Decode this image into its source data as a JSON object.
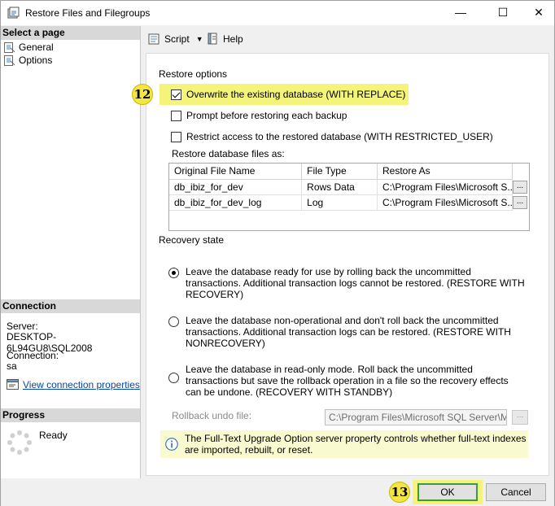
{
  "window": {
    "title": "Restore Files and Filegroups",
    "controls": {
      "minimize": "—",
      "maximize": "☐",
      "close": "✕"
    }
  },
  "left_panel": {
    "select_page_header": "Select a page",
    "pages": [
      {
        "label": "General",
        "icon": "page-icon"
      },
      {
        "label": "Options",
        "icon": "page-icon"
      }
    ],
    "connection_header": "Connection",
    "server_label": "Server:",
    "server_value": "DESKTOP-6L94GU8\\SQL2008",
    "connection_label": "Connection:",
    "connection_value": "sa",
    "view_connection_link": "View connection properties",
    "progress_header": "Progress",
    "progress_status": "Ready"
  },
  "toolbar": {
    "script_label": "Script",
    "help_label": "Help"
  },
  "options": {
    "restore_options_label": "Restore options",
    "overwrite_label": "Overwrite the existing database (WITH REPLACE)",
    "overwrite_checked": true,
    "prompt_label": "Prompt before restoring each backup",
    "prompt_checked": false,
    "restrict_label": "Restrict access to the restored database (WITH RESTRICTED_USER)",
    "restrict_checked": false,
    "restore_files_as_label": "Restore database files as:",
    "files_table": {
      "headers": [
        "Original File Name",
        "File Type",
        "Restore As"
      ],
      "rows": [
        [
          "db_ibiz_for_dev",
          "Rows Data",
          "C:\\Program Files\\Microsoft S..."
        ],
        [
          "db_ibiz_for_dev_log",
          "Log",
          "C:\\Program Files\\Microsoft S..."
        ]
      ],
      "browse_label": "..."
    },
    "recovery_state_label": "Recovery state",
    "recovery_options": [
      {
        "text": "Leave the database ready for use by rolling back the uncommitted transactions. Additional transaction logs cannot be restored. (RESTORE WITH RECOVERY)",
        "selected": true
      },
      {
        "text": "Leave the database non-operational and don't roll back the uncommitted transactions. Additional transaction logs can be restored. (RESTORE WITH NONRECOVERY)",
        "selected": false
      },
      {
        "text": "Leave the database in read-only mode. Roll back the uncommitted transactions but save the rollback operation in a file so the recovery effects can be undone. (RECOVERY WITH STANDBY)",
        "selected": false
      }
    ],
    "rollback_label": "Rollback undo file:",
    "rollback_value": "C:\\Program Files\\Microsoft SQL Server\\MSSC",
    "rollback_browse": "...",
    "info_text": "The Full-Text Upgrade Option server property controls whether full-text indexes are imported, rebuilt, or reset."
  },
  "annotations": {
    "step_12": "12",
    "step_13": "13",
    "highlight_color": "#f4f47a"
  },
  "footer": {
    "ok_label": "OK",
    "cancel_label": "Cancel"
  }
}
